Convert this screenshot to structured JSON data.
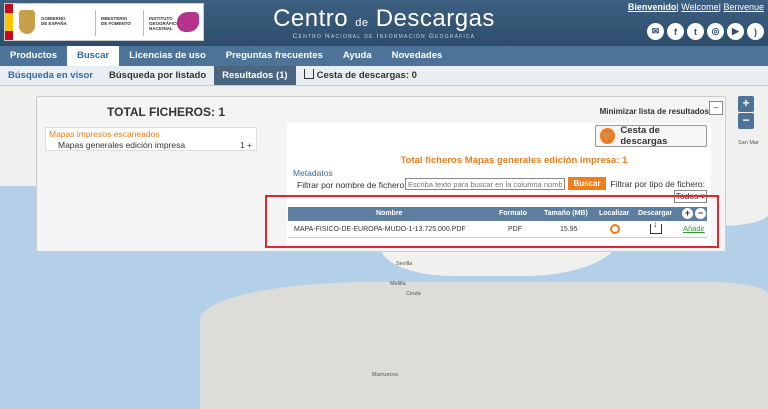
{
  "header": {
    "logo_texts": [
      "GOBIERNO DE ESPAÑA",
      "MINISTERIO DE FOMENTO",
      "INSTITUTO GEOGRÁFICO NACIONAL"
    ],
    "title_part1": "Centro",
    "title_small": "de",
    "title_part2": "Descargas",
    "subtitle": "Centro Nacional de Información Geográfica",
    "top_links": [
      "Bienvenido",
      "Welcome",
      "Benvenue"
    ],
    "social_icons": [
      "mail-icon",
      "facebook-icon",
      "twitter-icon",
      "instagram-icon",
      "youtube-icon",
      "rss-icon"
    ]
  },
  "mainnav": {
    "items": [
      "Productos",
      "Buscar",
      "Licencias de uso",
      "Preguntas frecuentes",
      "Ayuda",
      "Novedades"
    ],
    "active": "Buscar"
  },
  "subnav": {
    "items": [
      "Búsqueda en visor",
      "Búsqueda por listado",
      "Resultados (1)",
      "Cesta de descargas: 0"
    ],
    "active": "Resultados (1)"
  },
  "map": {
    "labels": [
      "Sevilla",
      "Melilla",
      "Ceuta",
      "Marruecos",
      "San Mar"
    ],
    "zoom_in": "+",
    "zoom_out": "−"
  },
  "panel": {
    "total_title": "TOTAL FICHEROS: 1",
    "minimize_label": "Minimizar lista de resultados",
    "minimize_btn": "–",
    "category_title": "Mapas impresos escaneados",
    "category_item": "Mapas generales edición impresa",
    "category_count": "1 +",
    "cesta_label": "Cesta de descargas",
    "total_line": "Total ficheros  Mapas generales edición impresa: 1",
    "metadatos": "Metadatos",
    "filter_label": "Filtrar por nombre de fichero:",
    "filter_placeholder": "Escriba texto para buscar en la columna nombre",
    "buscar_label": "Buscar",
    "tipo_label": "Filtrar por tipo de fichero:",
    "tipo_selected": "Todos"
  },
  "table": {
    "headers": [
      "Nombre",
      "Formato",
      "Tamaño (MB)",
      "Localizar",
      "Descargar"
    ],
    "header_buttons": [
      "+",
      "−"
    ],
    "rows": [
      {
        "nombre": "MAPA-FISICO-DE-EUROPA-MUDO-1-13.725.000.PDF",
        "formato": "PDF",
        "tamano": "15.95",
        "anadir": "Añadir"
      }
    ]
  },
  "colors": {
    "header_bg": "#2e4d6c",
    "nav_bg": "#4d7399",
    "accent_orange": "#f07d19",
    "highlight_red": "#e3262d",
    "sea": "#b4cfe8"
  }
}
